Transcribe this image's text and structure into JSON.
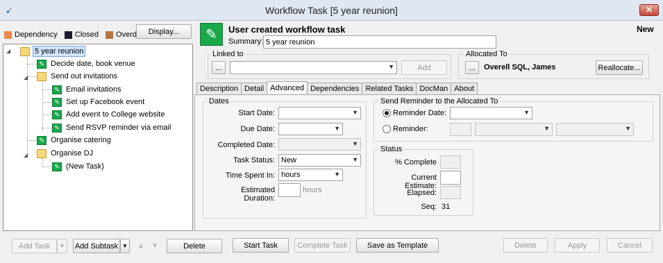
{
  "window": {
    "title": "Workflow Task  [5 year reunion]"
  },
  "legend": [
    {
      "label": "Dependency",
      "color": "#e8894a"
    },
    {
      "label": "Closed",
      "color": "#1c1c2a"
    },
    {
      "label": "Overdue",
      "color": "#b8743c"
    }
  ],
  "display_button": "Display...",
  "tree": {
    "root": "5 year reunion",
    "items": [
      "Decide date, book venue",
      "Send out invitations",
      "Email invitations",
      "Set up Facebook event",
      "Add event to College website",
      "Send RSVP reminder via email",
      "Organise catering",
      "Organise DJ",
      "(New Task)"
    ]
  },
  "header": {
    "title": "User created workflow task",
    "status": "New",
    "summary_label": "Summary:",
    "summary_value": "5 year reunion"
  },
  "linked_to": {
    "label": "Linked to",
    "browse": "...",
    "value": "",
    "add": "Add"
  },
  "allocated_to": {
    "label": "Allocated To",
    "browse": "...",
    "name": "Overell SQL, James",
    "reallocate": "Reallocate..."
  },
  "tabs": [
    "Description",
    "Detail",
    "Advanced",
    "Dependencies",
    "Related Tasks",
    "DocMan",
    "About"
  ],
  "dates": {
    "group": "Dates",
    "start_label": "Start Date:",
    "due_label": "Due Date:",
    "completed_label": "Completed Date:",
    "status_label": "Task Status:",
    "status_value": "New",
    "time_label": "Time Spent In:",
    "time_value": "hours",
    "duration_label": "Estimated Duration:",
    "duration_unit": "hours"
  },
  "reminder": {
    "group": "Send Reminder to the Allocated To",
    "date_label": "Reminder Date:",
    "reminder_label": "Reminder:"
  },
  "status": {
    "group": "Status",
    "complete_label": "% Complete",
    "estimate_label": "Current Estimate:",
    "elapsed_label": "Elapsed:",
    "seq_label": "Seq:",
    "seq_value": "31"
  },
  "bottom": {
    "add_task": "Add Task",
    "add_subtask": "Add Subtask",
    "delete": "Delete",
    "start_task": "Start Task",
    "complete_task": "Complete Task",
    "save_template": "Save as Template",
    "delete2": "Delete",
    "apply": "Apply",
    "cancel": "Cancel"
  }
}
